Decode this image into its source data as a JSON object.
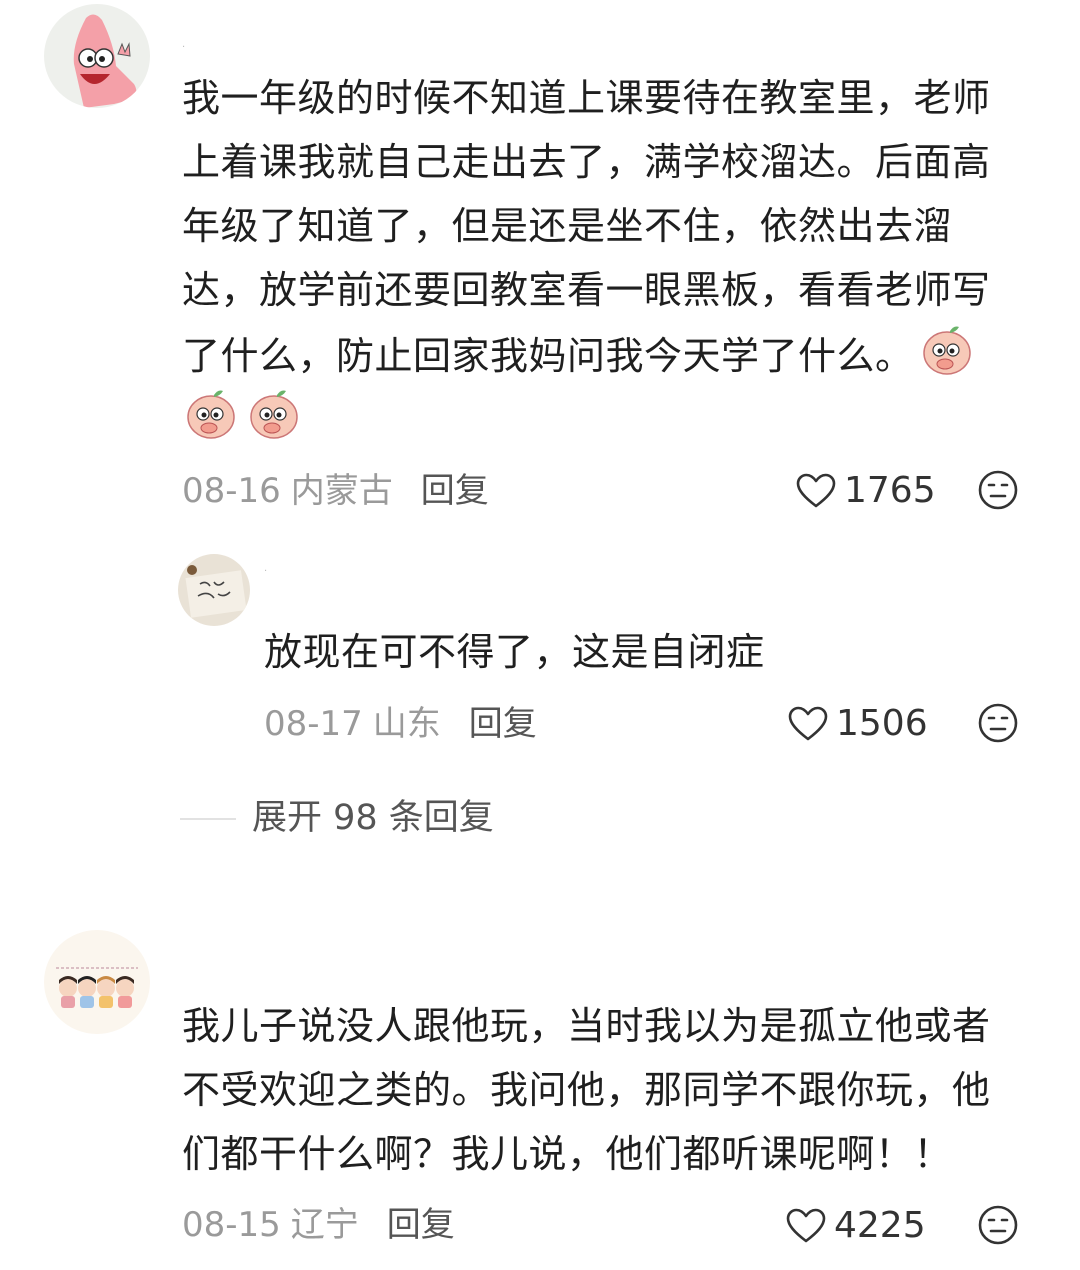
{
  "comments": [
    {
      "text_lines": [
        "我一年级的时候不知道上课要待在教室里，老师",
        "上着课我就自己走出去了，满学校溜达。后面高",
        "年级了知道了，但是还是坐不住，依然出去溜",
        "达，放学前还要回教室看一眼黑板，看看老师写",
        "了什么，防止回家我妈问我今天学了什么。"
      ],
      "date": "08-16",
      "location": "内蒙古",
      "reply_label": "回复",
      "likes": "1765",
      "emoji": "blushing-peach-emoji",
      "avatar": "patrick-star-avatar"
    },
    {
      "text_lines": [
        "放现在可不得了，这是自闭症"
      ],
      "date": "08-17",
      "location": "山东",
      "reply_label": "回复",
      "likes": "1506",
      "avatar": "handwriting-photo-avatar"
    },
    {
      "text_lines": [
        "我儿子说没人跟他玩，当时我以为是孤立他或者",
        "不受欢迎之类的。我问他，那同学不跟你玩，他",
        "们都干什么啊？我儿说，他们都听课呢啊！！"
      ],
      "date": "08-15",
      "location": "辽宁",
      "reply_label": "回复",
      "likes": "4225",
      "avatar": "cartoon-girls-avatar"
    }
  ],
  "expand": {
    "label": "展开 98 条回复"
  },
  "colors": {
    "text": "#1f1f1f",
    "meta": "#9a9a9a",
    "reply": "#555555",
    "background": "#ffffff"
  },
  "icons": {
    "like": "heart-outline-icon",
    "dislike": "neutral-face-icon"
  }
}
